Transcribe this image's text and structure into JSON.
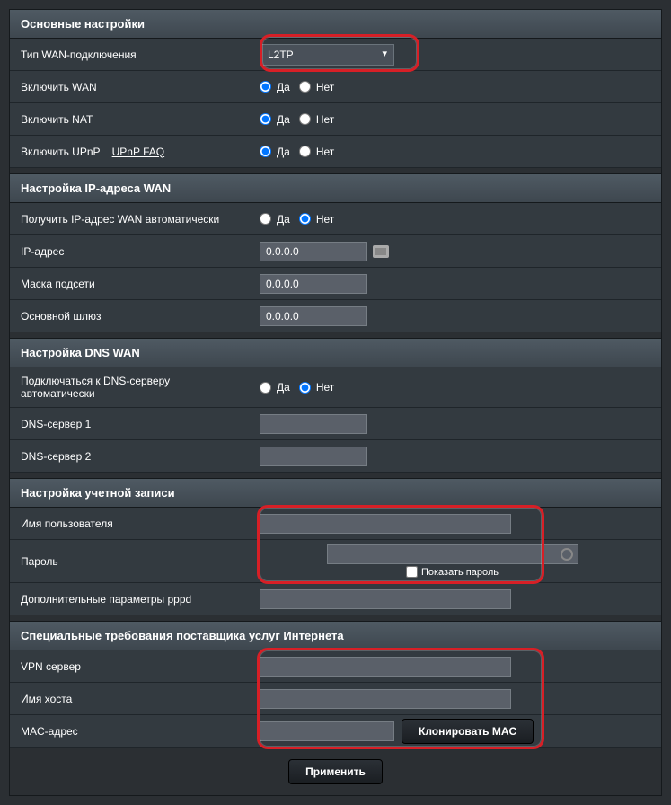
{
  "section_basic": {
    "title": "Основные настройки",
    "wan_type_label": "Тип WAN-подключения",
    "wan_type_value": "L2TP",
    "enable_wan": "Включить WAN",
    "enable_nat": "Включить NAT",
    "enable_upnp": "Включить UPnP",
    "upnp_faq": "UPnP  FAQ"
  },
  "radio": {
    "yes": "Да",
    "no": "Нет"
  },
  "section_ip": {
    "title": "Настройка IP-адреса WAN",
    "auto_label": "Получить IP-адрес WAN автоматически",
    "ip_label": "IP-адрес",
    "ip_value": "0.0.0.0",
    "mask_label": "Маска подсети",
    "mask_value": "0.0.0.0",
    "gateway_label": "Основной шлюз",
    "gateway_value": "0.0.0.0"
  },
  "section_dns": {
    "title": "Настройка DNS WAN",
    "auto_label": "Подключаться к DNS-серверу автоматически",
    "dns1_label": "DNS-сервер 1",
    "dns2_label": "DNS-сервер 2"
  },
  "section_acct": {
    "title": "Настройка учетной записи",
    "user_label": "Имя пользователя",
    "pass_label": "Пароль",
    "show_pass": "Показать пароль",
    "extra_label": "Дополнительные параметры pppd"
  },
  "section_isp": {
    "title": "Специальные требования поставщика услуг Интернета",
    "vpn_label": "VPN сервер",
    "host_label": "Имя хоста",
    "mac_label": "MAC-адрес",
    "clone_mac": "Клонировать MAC"
  },
  "apply_btn": "Применить"
}
